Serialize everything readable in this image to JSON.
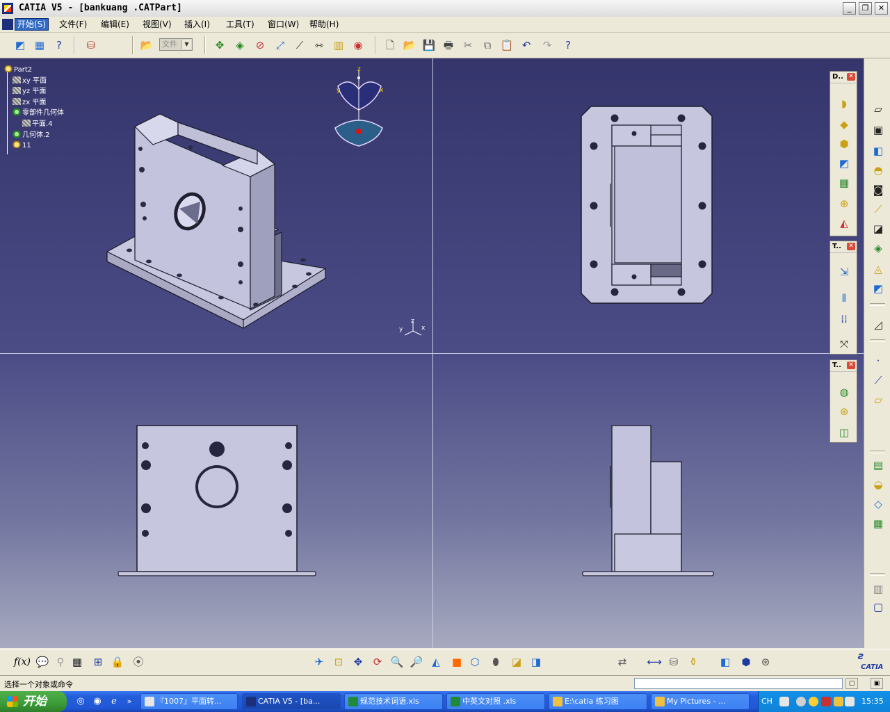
{
  "window": {
    "title": "CATIA V5 - [bankuang .CATPart]"
  },
  "menu": {
    "items": [
      "开始(S)",
      "文件(F)",
      "编辑(E)",
      "视图(V)",
      "插入(I)",
      "工具(T)",
      "窗口(W)",
      "帮助(H)"
    ]
  },
  "toolbar": {
    "file_combo": "文件"
  },
  "tree": {
    "nodes": [
      {
        "label": "Part2",
        "icon": "part-icon"
      },
      {
        "label": "xy 平面",
        "icon": "plane-icon"
      },
      {
        "label": "yz 平面",
        "icon": "plane-icon"
      },
      {
        "label": "zx 平面",
        "icon": "plane-icon"
      },
      {
        "label": "零部件几何体",
        "icon": "geometry-icon"
      },
      {
        "label": "平面.4",
        "icon": "plane-icon"
      },
      {
        "label": "几何体.2",
        "icon": "geometry-icon"
      },
      {
        "label": "11",
        "icon": "part-icon"
      }
    ]
  },
  "compass": {
    "z": "z",
    "y": "y",
    "x": "x"
  },
  "axis_triad": {
    "x": "x",
    "y": "y",
    "z": "z"
  },
  "panels": {
    "p1": "D..",
    "p2": "T..",
    "p3": "T.."
  },
  "status": {
    "message": "选择一个对象或命令"
  },
  "taskbar": {
    "start": "开始",
    "tasks": [
      "『1007』平面转...",
      "CATIA V5 - [ba...",
      "规范技术词语.xls",
      "中英文对照 .xls",
      "E:\\catia 练习图",
      "My Pictures - ..."
    ],
    "tray": {
      "lang": "CH",
      "time": "15:35"
    }
  },
  "brand": {
    "logo": "CATIA"
  }
}
